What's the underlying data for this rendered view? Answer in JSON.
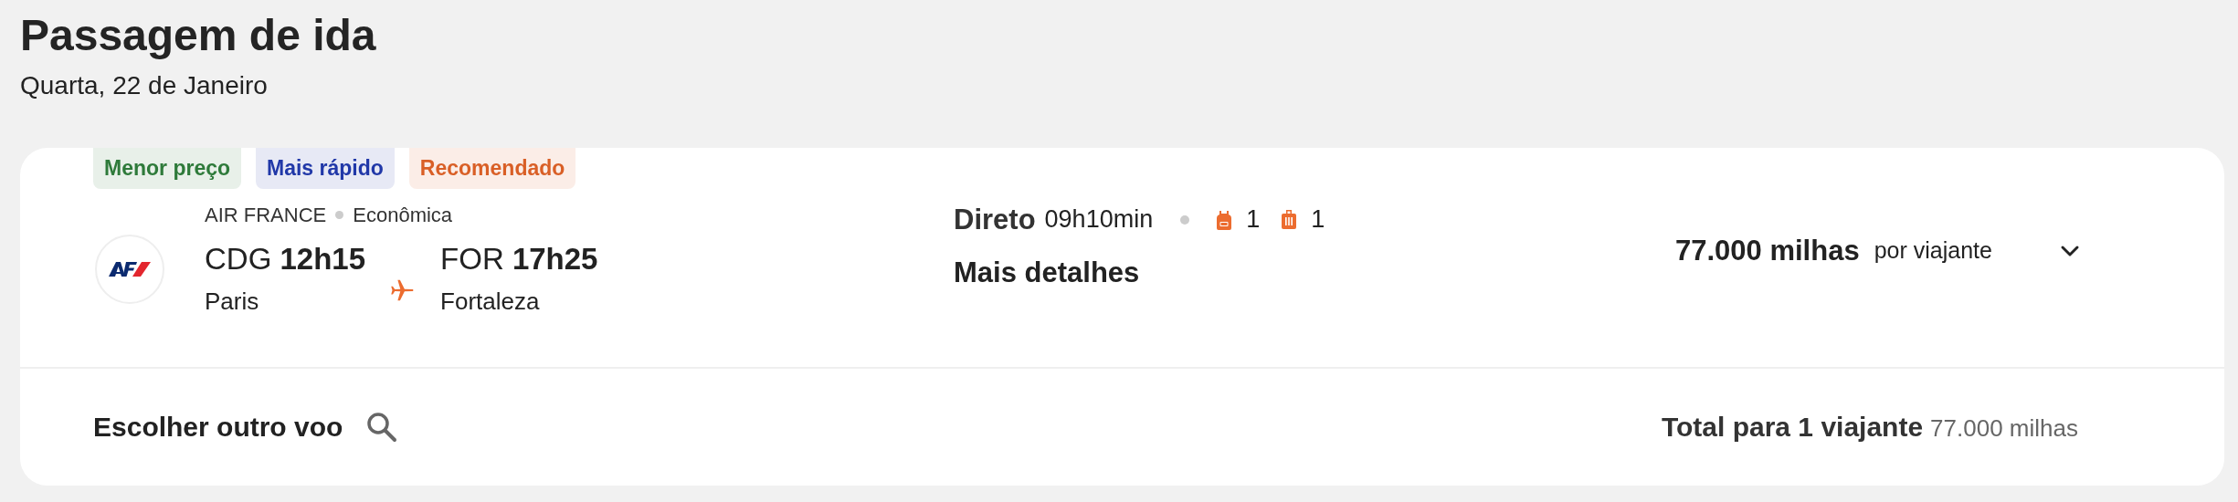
{
  "header": {
    "title": "Passagem de ida",
    "subtitle": "Quarta, 22 de Janeiro"
  },
  "flight": {
    "tags": [
      {
        "label": "Menor preço",
        "color": "#2e7a3a"
      },
      {
        "label": "Mais rápido",
        "color": "#2138a8"
      },
      {
        "label": "Recomendado",
        "color": "#d95f26"
      }
    ],
    "airline": "AIR FRANCE",
    "cabin": "Econômica",
    "departure": {
      "code": "CDG",
      "time": "12h15",
      "city": "Paris"
    },
    "arrival": {
      "code": "FOR",
      "time": "17h25",
      "city": "Fortaleza"
    },
    "stops": "Direto",
    "duration": "09h10min",
    "baggage": [
      {
        "kind": "backpack",
        "count": "1"
      },
      {
        "kind": "suitcase",
        "count": "1"
      }
    ],
    "details_link": "Mais detalhes",
    "price": "77.000 milhas",
    "price_note": "por viajante",
    "expanded": false
  },
  "footer": {
    "other_flight": "Escolher outro voo",
    "total_label": "Total para 1 viajante",
    "total_value": "77.000 milhas"
  }
}
